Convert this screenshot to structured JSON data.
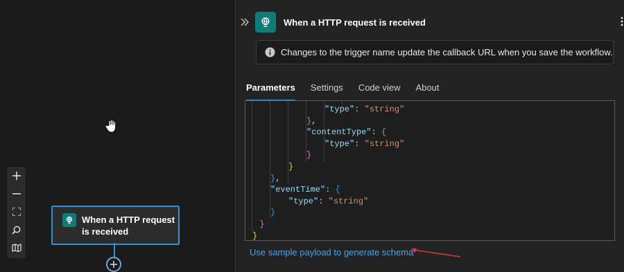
{
  "canvas": {
    "trigger_card": {
      "title": "When a HTTP request is received",
      "icon": "http-request-icon"
    },
    "zoom_controls": {
      "zoom_in": "plus-icon",
      "zoom_out": "minus-icon",
      "fit_view": "fit-view-icon",
      "search": "search-icon",
      "minimap": "map-icon"
    },
    "add_step_icon": "plus-circle-icon",
    "cursor": "hand-cursor-icon"
  },
  "panel": {
    "title": "When a HTTP request is received",
    "info_banner": {
      "text": "Changes to the trigger name update the callback URL when you save the workflow."
    },
    "tabs": [
      {
        "label": "Parameters",
        "active": true
      },
      {
        "label": "Settings",
        "active": false
      },
      {
        "label": "Code view",
        "active": false
      },
      {
        "label": "About",
        "active": false
      }
    ],
    "code_lines": [
      {
        "indent": 4,
        "tokens": [
          {
            "t": "\"type\"",
            "c": "key"
          },
          {
            "t": ": ",
            "c": "punc"
          },
          {
            "t": "\"string\"",
            "c": "str"
          }
        ]
      },
      {
        "indent": 3,
        "tokens": [
          {
            "t": "}",
            "c": "b2"
          },
          {
            "t": ",",
            "c": "punc"
          }
        ]
      },
      {
        "indent": 3,
        "tokens": [
          {
            "t": "\"contentType\"",
            "c": "key"
          },
          {
            "t": ": ",
            "c": "punc"
          },
          {
            "t": "{",
            "c": "b2"
          }
        ]
      },
      {
        "indent": 4,
        "tokens": [
          {
            "t": "\"type\"",
            "c": "key"
          },
          {
            "t": ": ",
            "c": "punc"
          },
          {
            "t": "\"string\"",
            "c": "str"
          }
        ]
      },
      {
        "indent": 3,
        "tokens": [
          {
            "t": "}",
            "c": "b2"
          }
        ]
      },
      {
        "indent": 2,
        "tokens": [
          {
            "t": "}",
            "c": "b1"
          }
        ]
      },
      {
        "indent": 1,
        "tokens": [
          {
            "t": "}",
            "c": "b3"
          },
          {
            "t": ",",
            "c": "punc"
          }
        ]
      },
      {
        "indent": 1,
        "tokens": [
          {
            "t": "\"eventTime\"",
            "c": "key"
          },
          {
            "t": ": ",
            "c": "punc"
          },
          {
            "t": "{",
            "c": "b3"
          }
        ]
      },
      {
        "indent": 2,
        "tokens": [
          {
            "t": "\"type\"",
            "c": "key"
          },
          {
            "t": ": ",
            "c": "punc"
          },
          {
            "t": "\"string\"",
            "c": "str"
          }
        ]
      },
      {
        "indent": 1,
        "tokens": [
          {
            "t": "}",
            "c": "b3"
          }
        ]
      },
      {
        "indent": 0.4,
        "tokens": [
          {
            "t": "}",
            "c": "b2"
          }
        ]
      },
      {
        "indent": 0,
        "tokens": [
          {
            "t": "}",
            "c": "b1"
          }
        ]
      }
    ],
    "sample_payload_link": "Use sample payload to generate schema"
  },
  "colors": {
    "accent": "#2f8fd7",
    "connector_teal": "#107c79",
    "annotation_arrow": "#d9363e",
    "link": "#4aa3e8"
  }
}
